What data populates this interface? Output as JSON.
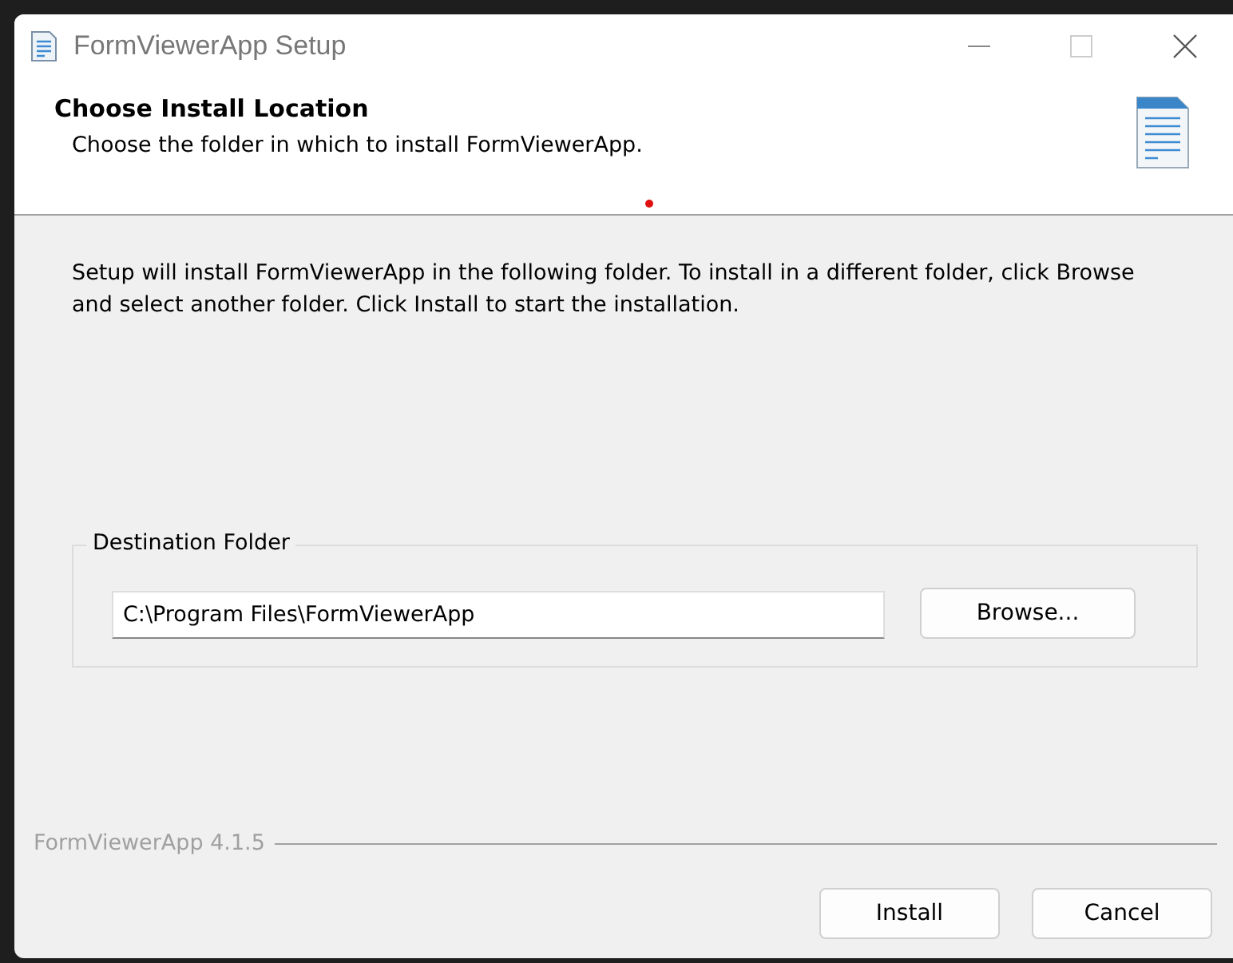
{
  "window": {
    "title": "FormViewerApp Setup"
  },
  "header": {
    "title": "Choose Install Location",
    "subtitle": "Choose the folder in which to install FormViewerApp."
  },
  "description": "Setup will install FormViewerApp in the following folder. To install in a different folder, click Browse and select another folder. Click Install to start the installation.",
  "destination": {
    "label": "Destination Folder",
    "value": "C:\\Program Files\\FormViewerApp",
    "browse": "Browse..."
  },
  "footer": {
    "brand": "FormViewerApp 4.1.5"
  },
  "buttons": [
    "Install",
    "Cancel"
  ]
}
